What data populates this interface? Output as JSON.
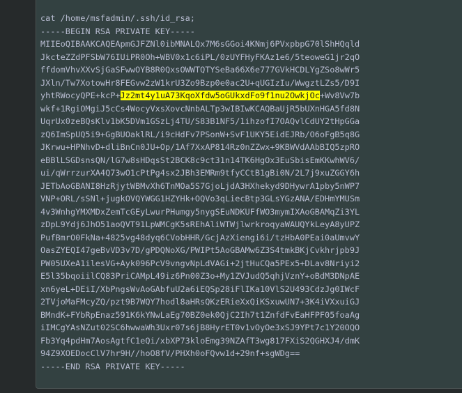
{
  "terminal": {
    "command": "cat /home/msfadmin/.ssh/id_rsa;",
    "begin": "-----BEGIN RSA PRIVATE KEY-----",
    "lines": [
      "MIIEoQIBAAKCAQEApmGJFZNl0ibMNALQx7M6sGGoi4KNmj6PVxpbpG70lShHQqld",
      "JkcteZZdPFSbW76IUiPR0Oh+WBV0x1c6iPL/0zUYFHyFKAz1e6/5teoweG1jr2qO",
      "ffdomVhvXXvSjGaSFwwOYB8R0QxsOWWTQTYSeBa66X6e777GVkHCDLYgZSo8wWr5",
      "JXln/Tw7XotowHr8FEGvw2zW1krU3Zo9Bzp0e0ac2U+qUGIzIu/WwgztLZs5/D9I",
      null,
      "wkf+1RgiOMgiJ5cCs4WocyVxsXovcNnbALTp3wIBIwKCAQBaUjR5bUXnHGA5fd8N",
      "UqrUx0zeBQsKlv1bK5DVm1GSzLj4TU/S83B1NF5/1ihzofI7OAQvlCdUY2tHpGGa",
      "zQ6ImSpUQ5i9+GgBUOaklRL/i9cHdFv7PSonW+SvF1UKY5EidEJRb/O6oFgB5q8G",
      "JKrwu+HPNhvD+dliBnCn0JU+Op/1Af7XxAP814Rz0nZZwx+9KBWVdAAbBIQ5zpRO",
      "eBBlLSGDsnsQN/lG7w8sHDqsSt2BCK8c9ct31n14TK6HgOx3EuSbisEmKKwhWV6/",
      "ui/qWrrzurXA4Q73wO1cPtPg4sx2JBh3EMRm9tfyCCtB1gBi0N/2L7j9xuZGGY6h",
      "JETbAoGBANI8HzRjytWBMvXh6TnMOa5S7GjoLjdA3HXhekyd9DHywrA1pby5nWP7",
      "VNP+ORL/sSNl+jugkOVQYWGG1HZYHk+OQVo3qLiecBtp3GLsYGzANA/EDHmYMUSm",
      "4v3WnhgYMXMDxZemTcGEyLwurPHumgy5nygSEuNDKUFfWO3mymIXAoGBAMqZi3YL",
      "zDpL9Ydj6JhO51aoQVT91LpWMCgK5sREhAliWTWjlwrkroqyaWAUQYkLeyA8yUPZ",
      "PufBmrO0FkNa+4825vg48dyq6CVobHHR/GcjAzXiengi6i/tzHbA0PEai0aUmvwY",
      "OasZYEQI47geBvVD3v7D/gPDQNoXG/PWIPt5AoGBAMw6Z3S4tmkBKjCvkhrjpb9J",
      "PW05UXeA1ilesVG+Ayk096PcV9vngvNpLdVAGi+2jtHuCQa5PEx5+DLav8Nriyi2",
      "E5l35bqoiilCQ83PriCAMpL49iz6Pn00Z3o+My1ZVJudQ5qhjVznY+oBdM3DNpAE",
      "xn6yeL+DEiI/XbPngsWvAoGAbfuU2a6iEQSp28iFlIKa10VlS2U493CdzJg0IWcF",
      "2TVjoMaFMcyZQ/pzt9B7WQY7hodl8aHRsQKzERieXxQiKSxuwUN7+3K4iVXxuiGJ",
      "BMndK+FYbRpEnaz591K6kYNwLaEg70BZ0ek0QjC2Ih7t1ZnfdFvEaHFPF05foaAg",
      "iIMCgYAsNZut02SC6hwwaWh3Uxr07s6jB8HyrET0v1vOyOe3xSJ9YPt7c1Y20OQO",
      "Fb3Yq4pdHm7AosAgtfC1eQi/xbXP73kloEmg39NZAfT3wg817FXiS2QGHXJ4/dmK",
      "94Z9XOEDocClV7hr9H//hoO8fV/PHXh0oFQvw1d+29nf+sgWDg=="
    ],
    "highlighted_line": {
      "before": "yhtRWocyQPE+kcP+",
      "highlight": "Jz2mt4y1uA73KqoXfdw5oGUkxdFo9f1nu2OwkjOc",
      "after": "+Wv8Vw7b"
    },
    "end": "-----END RSA PRIVATE KEY-----",
    "colors": {
      "text": "#b9bdd2",
      "background": "#334141",
      "highlight": "#ffff00"
    }
  }
}
